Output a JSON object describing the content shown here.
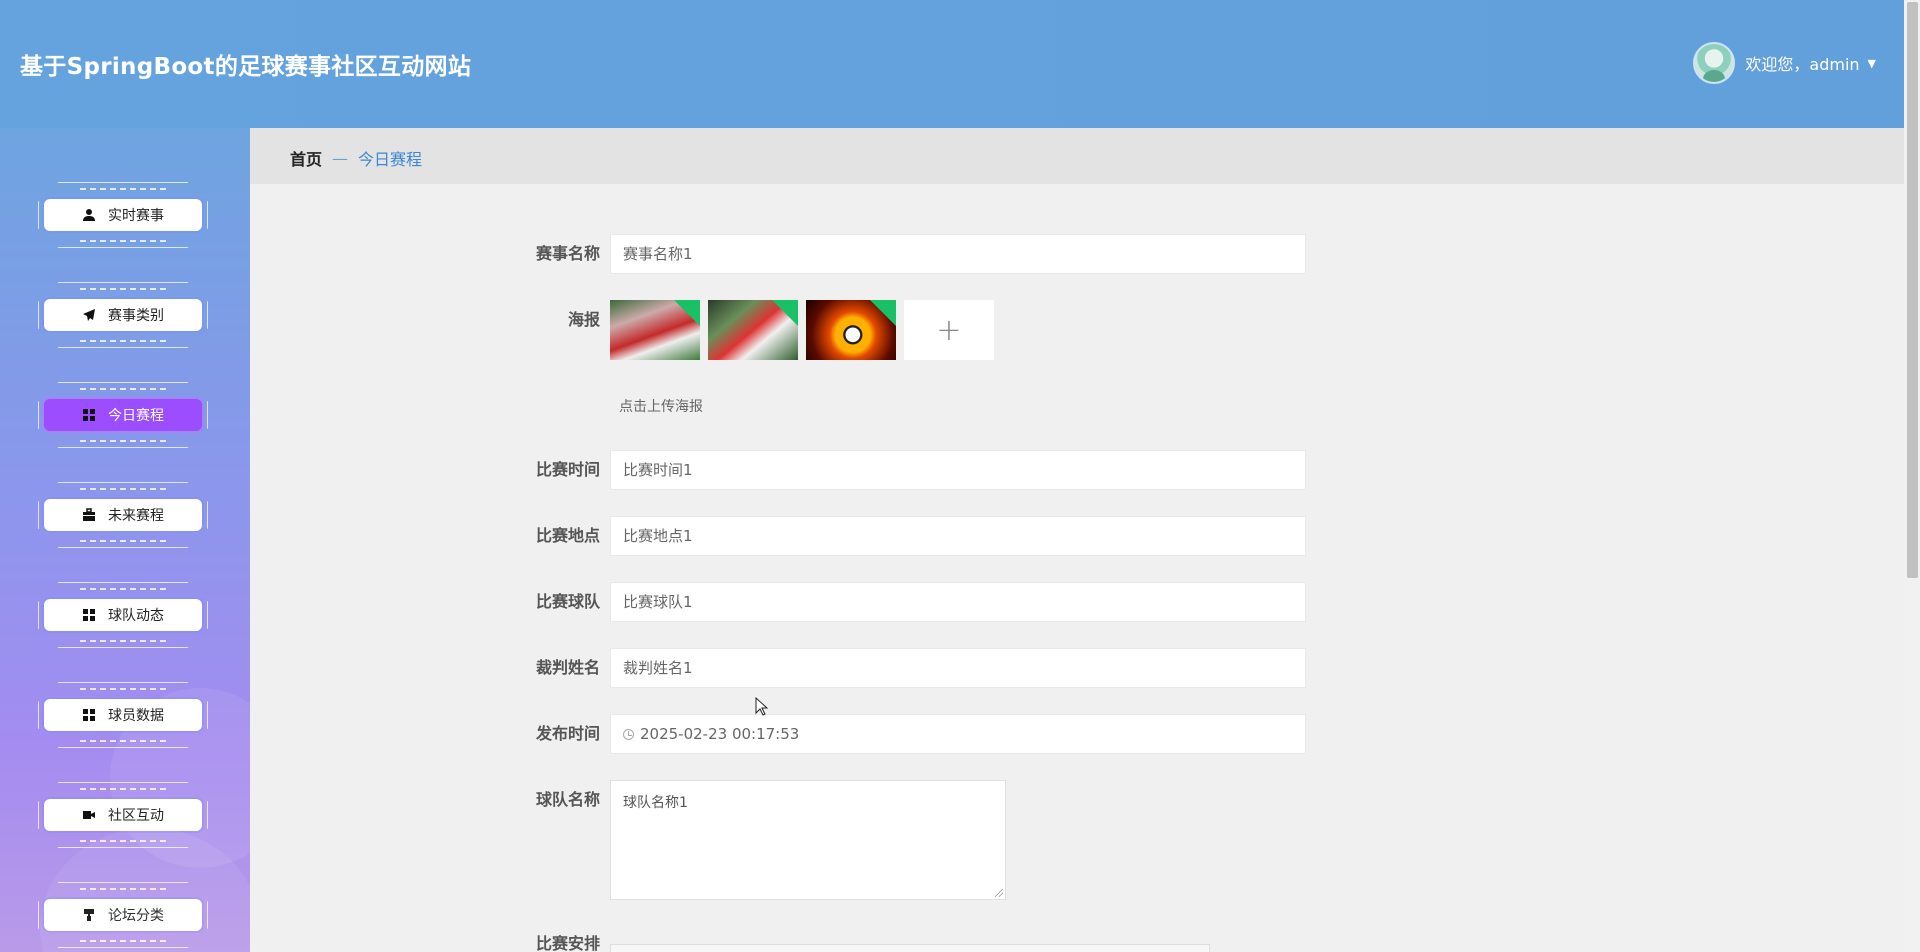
{
  "header": {
    "title": "基于SpringBoot的足球赛事社区互动网站",
    "welcome": "欢迎您，admin",
    "colors": {
      "bar": "#64a3de"
    }
  },
  "sidebar": {
    "items": [
      {
        "label": "实时赛事",
        "icon": "user-icon",
        "active": false
      },
      {
        "label": "赛事类别",
        "icon": "paper-plane-icon",
        "active": false
      },
      {
        "label": "今日赛程",
        "icon": "grid-icon",
        "active": true
      },
      {
        "label": "未来赛程",
        "icon": "briefcase-icon",
        "active": false
      },
      {
        "label": "球队动态",
        "icon": "grid-icon",
        "active": false
      },
      {
        "label": "球员数据",
        "icon": "grid-icon",
        "active": false
      },
      {
        "label": "社区互动",
        "icon": "video-camera-icon",
        "active": false
      },
      {
        "label": "论坛分类",
        "icon": "paint-roller-icon",
        "active": false
      }
    ],
    "colors": {
      "active": "#9b4dff"
    }
  },
  "breadcrumb": {
    "home": "首页",
    "separator": "—",
    "current": "今日赛程"
  },
  "form": {
    "event_name": {
      "label": "赛事名称",
      "value": "赛事名称1"
    },
    "poster": {
      "label": "海报",
      "hint": "点击上传海报",
      "upload_symbol": "+"
    },
    "match_time": {
      "label": "比赛时间",
      "value": "比赛时间1"
    },
    "match_place": {
      "label": "比赛地点",
      "value": "比赛地点1"
    },
    "match_team": {
      "label": "比赛球队",
      "value": "比赛球队1"
    },
    "referee": {
      "label": "裁判姓名",
      "value": "裁判姓名1"
    },
    "publish_time": {
      "label": "发布时间",
      "value": "2025-02-23 00:17:53"
    },
    "team_name": {
      "label": "球队名称",
      "value": "球队名称1"
    },
    "schedule": {
      "label": "比赛安排"
    }
  }
}
